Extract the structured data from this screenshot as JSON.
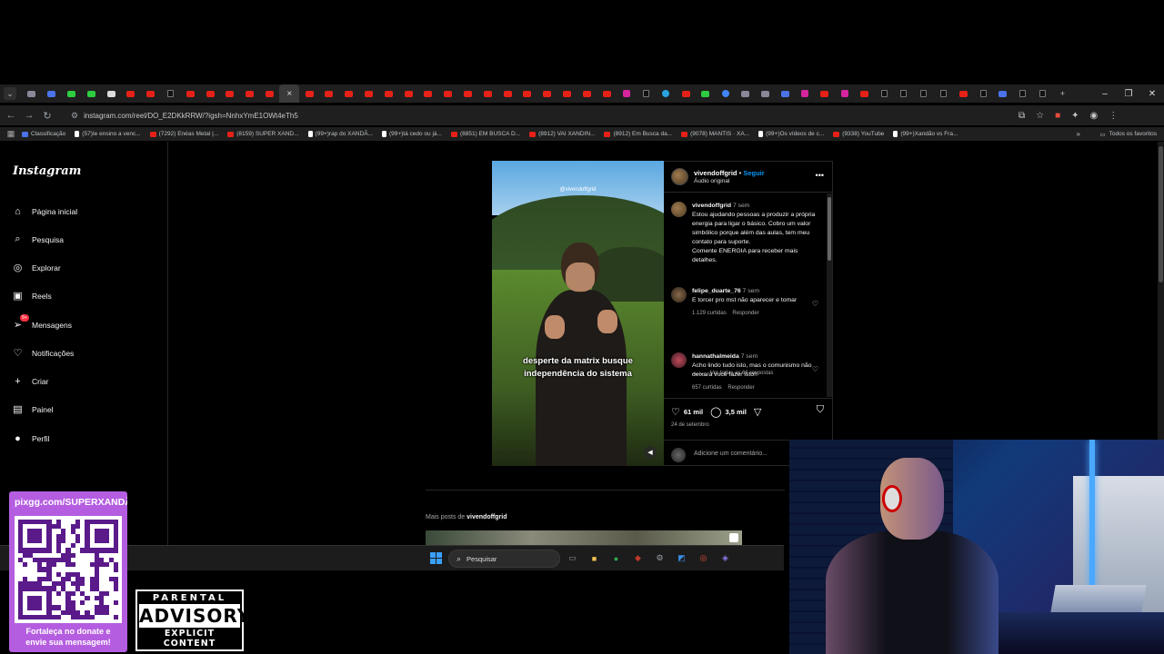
{
  "browser": {
    "tab_favicons": [
      "grey",
      "bl",
      "gr",
      "gr",
      "wh",
      "yt",
      "yt",
      "tt",
      "yt",
      "yt",
      "yt",
      "yt",
      "yt",
      "active",
      "yt",
      "yt",
      "yt",
      "yt",
      "yt",
      "yt",
      "yt",
      "yt",
      "yt",
      "yt",
      "yt",
      "yt",
      "yt",
      "yt",
      "yt",
      "yt",
      "ig",
      "tt",
      "tg",
      "yt",
      "gr",
      "g",
      "grey",
      "grey",
      "bl",
      "ig",
      "yt",
      "ig",
      "yt",
      "tt",
      "tt",
      "tt",
      "tt",
      "yt",
      "tt",
      "bl",
      "tt",
      "tt"
    ],
    "active_tab_close": "×",
    "new_tab": "+",
    "window_controls": {
      "minimize": "–",
      "maximize": "❐",
      "close": "✕"
    },
    "url": "instagram.com/reel/DO_E2DKkRRW/?igsh=NnhxYmE1OWt4eTh5",
    "bookmarks": [
      {
        "icon": "cl",
        "label": "Classificação"
      },
      {
        "icon": "tt",
        "label": "(57)Ie ensino a venc..."
      },
      {
        "icon": "yt",
        "label": "(7292) Enéas Metal |..."
      },
      {
        "icon": "yt",
        "label": "(8159) SUPER XAND..."
      },
      {
        "icon": "tt",
        "label": "(99+)rap do XANDÃ..."
      },
      {
        "icon": "tt",
        "label": "(99+)tá cedo ou já..."
      },
      {
        "icon": "yt",
        "label": "(8851) EM BUSCA D..."
      },
      {
        "icon": "yt",
        "label": "(8912) VAI XANDIN..."
      },
      {
        "icon": "yt",
        "label": "(8912) Em Busca da..."
      },
      {
        "icon": "yt",
        "label": "(9078) MANTIS · XA..."
      },
      {
        "icon": "tt",
        "label": "(99+)Os vídeos de c..."
      },
      {
        "icon": "yt",
        "label": "(9338) YouTube"
      },
      {
        "icon": "tt",
        "label": "(99+)Xandão vs Fra..."
      }
    ],
    "bookmarks_more": "»",
    "all_bookmarks": "Todos os favoritos"
  },
  "instagram": {
    "logo": "Instagram",
    "nav": [
      {
        "key": "home",
        "icon": "⌂",
        "label": "Página inicial"
      },
      {
        "key": "search",
        "icon": "⌕",
        "label": "Pesquisa"
      },
      {
        "key": "explore",
        "icon": "◎",
        "label": "Explorar"
      },
      {
        "key": "reels",
        "icon": "▣",
        "label": "Reels"
      },
      {
        "key": "messages",
        "icon": "➢",
        "label": "Mensagens",
        "badge": "9+"
      },
      {
        "key": "notifications",
        "icon": "♡",
        "label": "Notificações"
      },
      {
        "key": "create",
        "icon": "+",
        "label": "Criar"
      },
      {
        "key": "dashboard",
        "icon": "▤",
        "label": "Painel"
      },
      {
        "key": "profile",
        "icon": "●",
        "label": "Perfil"
      }
    ],
    "reel": {
      "watermark": "@vivendoffgrid",
      "caption_line1": "desperte da matrix busque",
      "caption_line2": "independência do sistema"
    },
    "post": {
      "username": "vivendoffgrid",
      "follow": "Seguir",
      "audio": "Áudio original",
      "more": "•••",
      "comments": [
        {
          "user": "vivendoffgrid",
          "time": "7 sem",
          "text": "Estou ajudando pessoas a produzir a própria energia para ligar o básico. Cobro um valor simbólico porque além das aulas, tem meu contato para suporte.\nComente ENERGIA para receber mais detalhes.",
          "likes": "",
          "reply": ""
        },
        {
          "user": "felipe_duarte_76",
          "time": "7 sem",
          "text": "E torcer pro mst não aparecer e tomar",
          "likes": "1.129 curtidas",
          "reply": "Responder"
        },
        {
          "user": "hannathalmeida",
          "time": "7 sem",
          "text": "Acho lindo tudo isto, mas o comunismo não deixará você fazer isto!!",
          "likes": "657 curtidas",
          "reply": "Responder"
        }
      ],
      "view_replies": "Ver todas as 66 respostas",
      "likes_count": "61 mil",
      "comments_count": "3,5 mil",
      "date": "24 de setembro",
      "add_comment_placeholder": "Adicione um comentário..."
    },
    "more_posts_prefix": "Mais posts de",
    "more_posts_user": "vivendoffgrid"
  },
  "taskbar": {
    "search_placeholder": "Pesquisar",
    "apps": [
      {
        "name": "task-view",
        "glyph": "▭",
        "color": "#888888"
      },
      {
        "name": "file-explorer",
        "glyph": "■",
        "color": "#f2c14e"
      },
      {
        "name": "chrome",
        "glyph": "●",
        "color": "#34a853"
      },
      {
        "name": "steam",
        "glyph": "◆",
        "color": "#c0392b"
      },
      {
        "name": "settings",
        "glyph": "⚙",
        "color": "#9aa0a6"
      },
      {
        "name": "photos",
        "glyph": "◩",
        "color": "#3a8ee6"
      },
      {
        "name": "app-red",
        "glyph": "◎",
        "color": "#e74c3c"
      },
      {
        "name": "app-purple",
        "glyph": "◈",
        "color": "#8a7cf0"
      }
    ]
  },
  "overlay": {
    "qr_url": "pixgg.com/SUPERXANDÃO",
    "qr_message_line1": "Fortaleça no donate e",
    "qr_message_line2": "envie sua mensagem!",
    "advisory_line1": "PARENTAL",
    "advisory_line2": "ADVISORY",
    "advisory_line3": "EXPLICIT CONTENT"
  }
}
